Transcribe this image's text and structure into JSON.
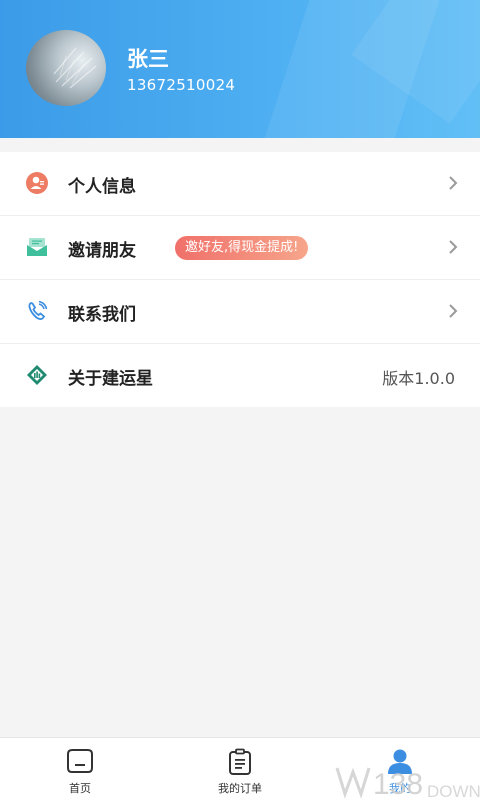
{
  "header": {
    "user_name": "张三",
    "user_phone": "13672510024",
    "background_color": "#4aa8ef"
  },
  "menu": {
    "items": [
      {
        "label": "个人信息",
        "icon": "user-icon",
        "icon_color": "#ee7b63"
      },
      {
        "label": "邀请朋友",
        "icon": "envelope-icon",
        "icon_color": "#3fbf9b",
        "badge": "邀好友,得现金提成!"
      },
      {
        "label": "联系我们",
        "icon": "phone-icon",
        "icon_color": "#3b8ee0"
      },
      {
        "label": "关于建运星",
        "icon": "app-logo-icon",
        "icon_color": "#1f8a6f",
        "value": "版本1.0.0"
      }
    ]
  },
  "tabbar": {
    "tabs": [
      {
        "label": "首页",
        "icon": "home-icon"
      },
      {
        "label": "我的订单",
        "icon": "clipboard-icon"
      },
      {
        "label": "我的",
        "icon": "person-icon",
        "active": true
      }
    ],
    "active_color": "#3b8ee0"
  },
  "watermark": {
    "text": "138",
    "suffix": "DOWN"
  }
}
